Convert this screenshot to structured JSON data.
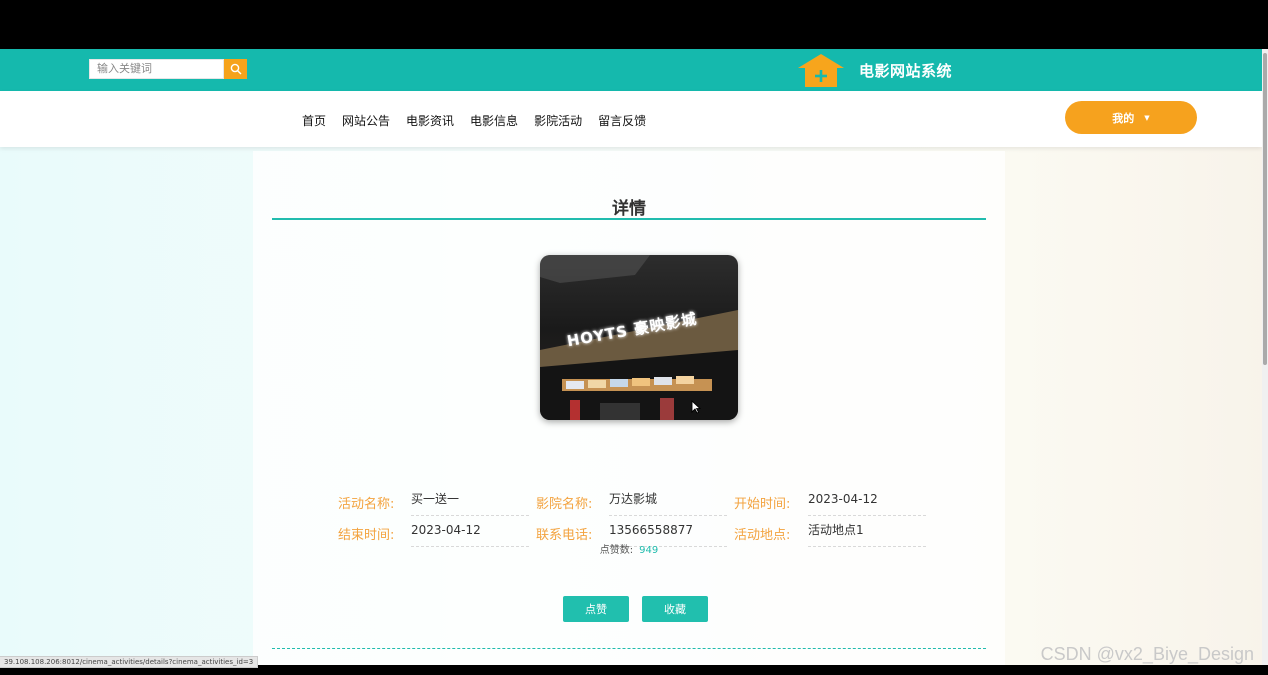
{
  "header": {
    "search_placeholder": "输入关键词",
    "site_title": "电影网站系统"
  },
  "nav": {
    "items": [
      "首页",
      "网站公告",
      "电影资讯",
      "电影信息",
      "影院活动",
      "留言反馈"
    ],
    "my_label": "我的"
  },
  "detail": {
    "title": "详情",
    "photo_sign": "HOYTS 豪映影城",
    "fields": [
      {
        "label": "活动名称:",
        "value": "买一送一"
      },
      {
        "label": "影院名称:",
        "value": "万达影城"
      },
      {
        "label": "开始时间:",
        "value": "2023-04-12"
      },
      {
        "label": "结束时间:",
        "value": "2023-04-12"
      },
      {
        "label": "联系电话:",
        "value": "13566558877"
      },
      {
        "label": "活动地点:",
        "value": "活动地点1"
      }
    ],
    "likes_label": "点赞数:",
    "likes_count": "949",
    "like_button": "点赞",
    "favorite_button": "收藏"
  },
  "status_bar": {
    "url": "39.108.108.206:8012/cinema_activities/details?cinema_activities_id=3"
  },
  "watermark": "CSDN @vx2_Biye_Design",
  "colors": {
    "primary": "#15b9ad",
    "accent": "#f6a21e",
    "label": "#f3a33f"
  }
}
